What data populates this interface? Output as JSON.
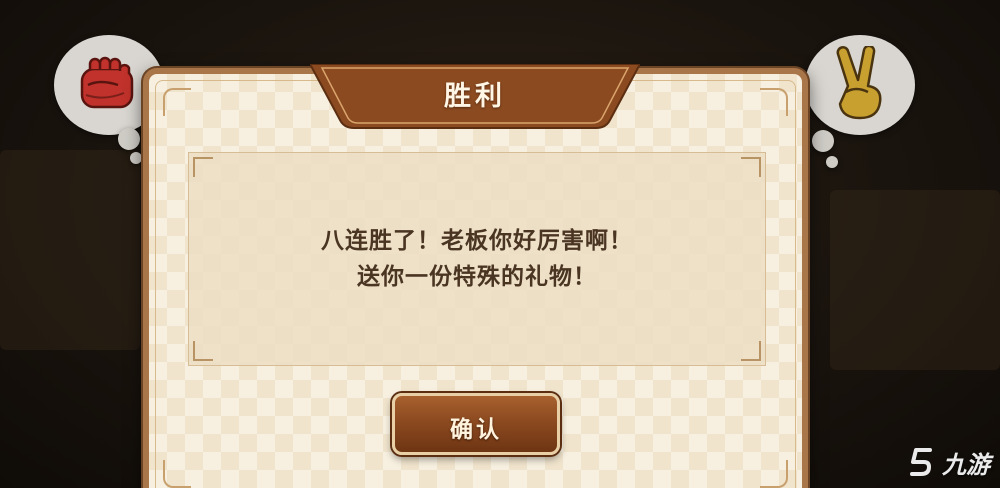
{
  "dialog": {
    "title": "胜利",
    "message_line1": "八连胜了！老板你好厉害啊！",
    "message_line2": "送你一份特殊的礼物！",
    "confirm_label": "确认"
  },
  "left_bubble": {
    "icon": "fist-icon",
    "color": "#c0322b"
  },
  "right_bubble": {
    "icon": "victory-hand-icon",
    "color": "#c8a030"
  },
  "watermark": {
    "text": "九游"
  },
  "colors": {
    "dialog_border": "#a9764a",
    "banner": "#8c4a20",
    "button": "#8c4a20",
    "text_dark": "#4a3422"
  }
}
